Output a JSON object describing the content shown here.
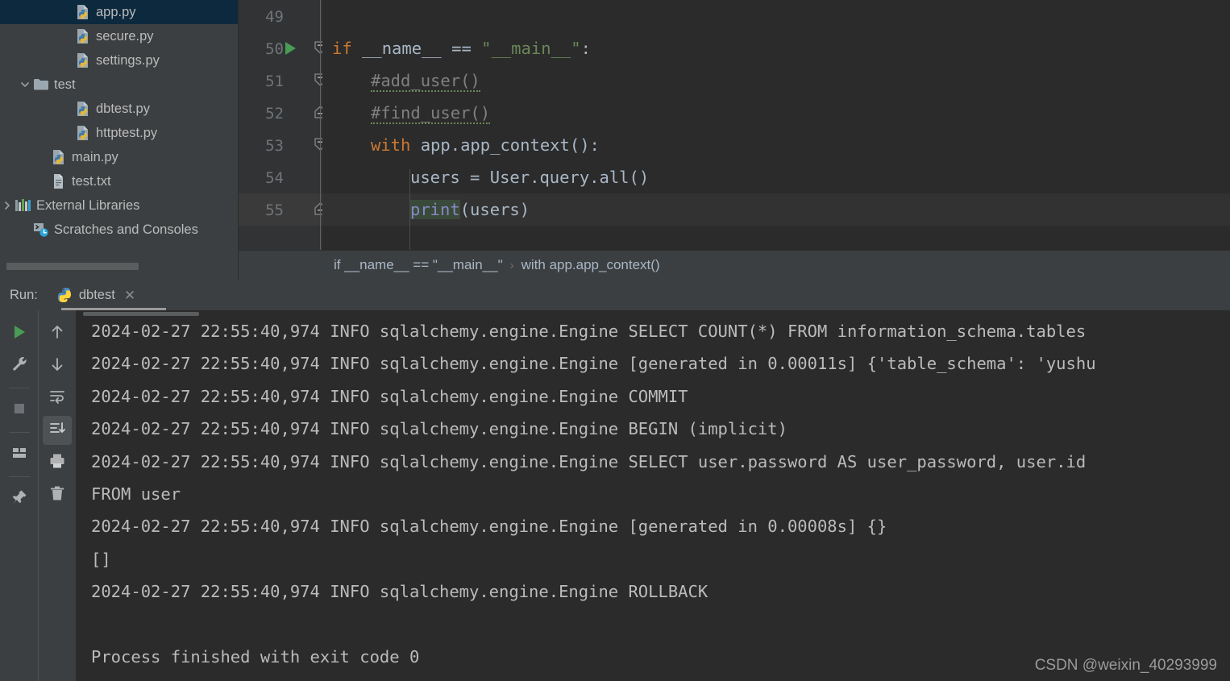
{
  "project": {
    "scrollbar": "horizontal-scrollbar",
    "items": [
      {
        "label": "app.py",
        "icon": "python-file-icon",
        "indent": 92,
        "selected": true,
        "arrow": ""
      },
      {
        "label": "secure.py",
        "icon": "python-file-icon",
        "indent": 92,
        "selected": false,
        "arrow": ""
      },
      {
        "label": "settings.py",
        "icon": "python-file-icon",
        "indent": 92,
        "selected": false,
        "arrow": ""
      },
      {
        "label": "test",
        "icon": "folder-icon",
        "indent": 40,
        "selected": false,
        "arrow": "chevron-down-icon"
      },
      {
        "label": "dbtest.py",
        "icon": "python-file-icon",
        "indent": 92,
        "selected": false,
        "arrow": ""
      },
      {
        "label": "httptest.py",
        "icon": "python-file-icon",
        "indent": 92,
        "selected": false,
        "arrow": ""
      },
      {
        "label": "main.py",
        "icon": "python-file-icon",
        "indent": 62,
        "selected": false,
        "arrow": ""
      },
      {
        "label": "test.txt",
        "icon": "text-file-icon",
        "indent": 62,
        "selected": false,
        "arrow": ""
      },
      {
        "label": "External Libraries",
        "icon": "libraries-icon",
        "indent": 12,
        "selected": false,
        "arrow": "chevron-right-icon"
      },
      {
        "label": "Scratches and Consoles",
        "icon": "scratches-icon",
        "indent": 40,
        "selected": false,
        "arrow": ""
      }
    ]
  },
  "editor": {
    "partial_top_line": "48",
    "lines": [
      {
        "num": "49",
        "indent": 0,
        "runnable": false,
        "fold": "",
        "current": false,
        "tokens": []
      },
      {
        "num": "50",
        "indent": 0,
        "runnable": true,
        "fold": "fold-down-icon",
        "current": false,
        "tokens": [
          {
            "t": "if",
            "c": "kw"
          },
          {
            "t": " __name__ == ",
            "c": ""
          },
          {
            "t": "\"__main__\"",
            "c": "str"
          },
          {
            "t": ":",
            "c": ""
          }
        ]
      },
      {
        "num": "51",
        "indent": 48,
        "runnable": false,
        "fold": "fold-down-icon",
        "current": false,
        "tokens": [
          {
            "t": "#add_user()",
            "c": "cmt wave"
          }
        ]
      },
      {
        "num": "52",
        "indent": 48,
        "runnable": false,
        "fold": "fold-up-icon",
        "current": false,
        "tokens": [
          {
            "t": "#find_user()",
            "c": "cmt wave"
          }
        ]
      },
      {
        "num": "53",
        "indent": 48,
        "runnable": false,
        "fold": "fold-down-icon",
        "current": false,
        "tokens": [
          {
            "t": "with",
            "c": "kw"
          },
          {
            "t": " app.app_context():",
            "c": ""
          }
        ]
      },
      {
        "num": "54",
        "indent": 97,
        "runnable": false,
        "fold": "",
        "current": false,
        "tokens": [
          {
            "t": "users = User.query.all()",
            "c": ""
          }
        ]
      },
      {
        "num": "55",
        "indent": 97,
        "runnable": false,
        "fold": "fold-up-icon",
        "current": true,
        "tokens": [
          {
            "t": "print",
            "c": "fn selprint"
          },
          {
            "t": "(users)",
            "c": ""
          }
        ]
      }
    ]
  },
  "breadcrumb": {
    "items": [
      "if __name__ == \"__main__\"",
      "with app.app_context()"
    ],
    "separator": "›"
  },
  "run": {
    "label": "Run:",
    "tab_name": "dbtest",
    "tab_icon": "python-icon",
    "close_icon": "close-icon",
    "toolbar_left": [
      {
        "name": "rerun-button",
        "icon": "play-icon"
      },
      {
        "name": "modify-run-config-button",
        "icon": "wrench-icon"
      },
      {
        "name": "stop-button",
        "icon": "stop-icon"
      },
      {
        "name": "layout-settings-button",
        "icon": "layout-icon"
      },
      {
        "name": "pin-tab-button",
        "icon": "pin-icon"
      }
    ],
    "toolbar_right": [
      {
        "name": "prev-occurrence-button",
        "icon": "arrow-up-icon",
        "active": false
      },
      {
        "name": "next-occurrence-button",
        "icon": "arrow-down-icon",
        "active": false
      },
      {
        "name": "soft-wrap-button",
        "icon": "soft-wrap-icon",
        "active": false
      },
      {
        "name": "scroll-to-end-button",
        "icon": "scroll-end-icon",
        "active": true
      },
      {
        "name": "print-button",
        "icon": "printer-icon",
        "active": false
      },
      {
        "name": "clear-all-button",
        "icon": "trash-icon",
        "active": false
      }
    ]
  },
  "console": {
    "lines": [
      "2024-02-27 22:55:40,974 INFO sqlalchemy.engine.Engine SELECT COUNT(*) FROM information_schema.tables",
      "2024-02-27 22:55:40,974 INFO sqlalchemy.engine.Engine [generated in 0.00011s] {'table_schema': 'yushu",
      "2024-02-27 22:55:40,974 INFO sqlalchemy.engine.Engine COMMIT",
      "2024-02-27 22:55:40,974 INFO sqlalchemy.engine.Engine BEGIN (implicit)",
      "2024-02-27 22:55:40,974 INFO sqlalchemy.engine.Engine SELECT user.password AS user_password, user.id",
      "FROM user",
      "2024-02-27 22:55:40,974 INFO sqlalchemy.engine.Engine [generated in 0.00008s] {}",
      "[]",
      "2024-02-27 22:55:40,974 INFO sqlalchemy.engine.Engine ROLLBACK",
      "",
      "Process finished with exit code 0"
    ]
  },
  "watermark": "CSDN @weixin_40293999"
}
